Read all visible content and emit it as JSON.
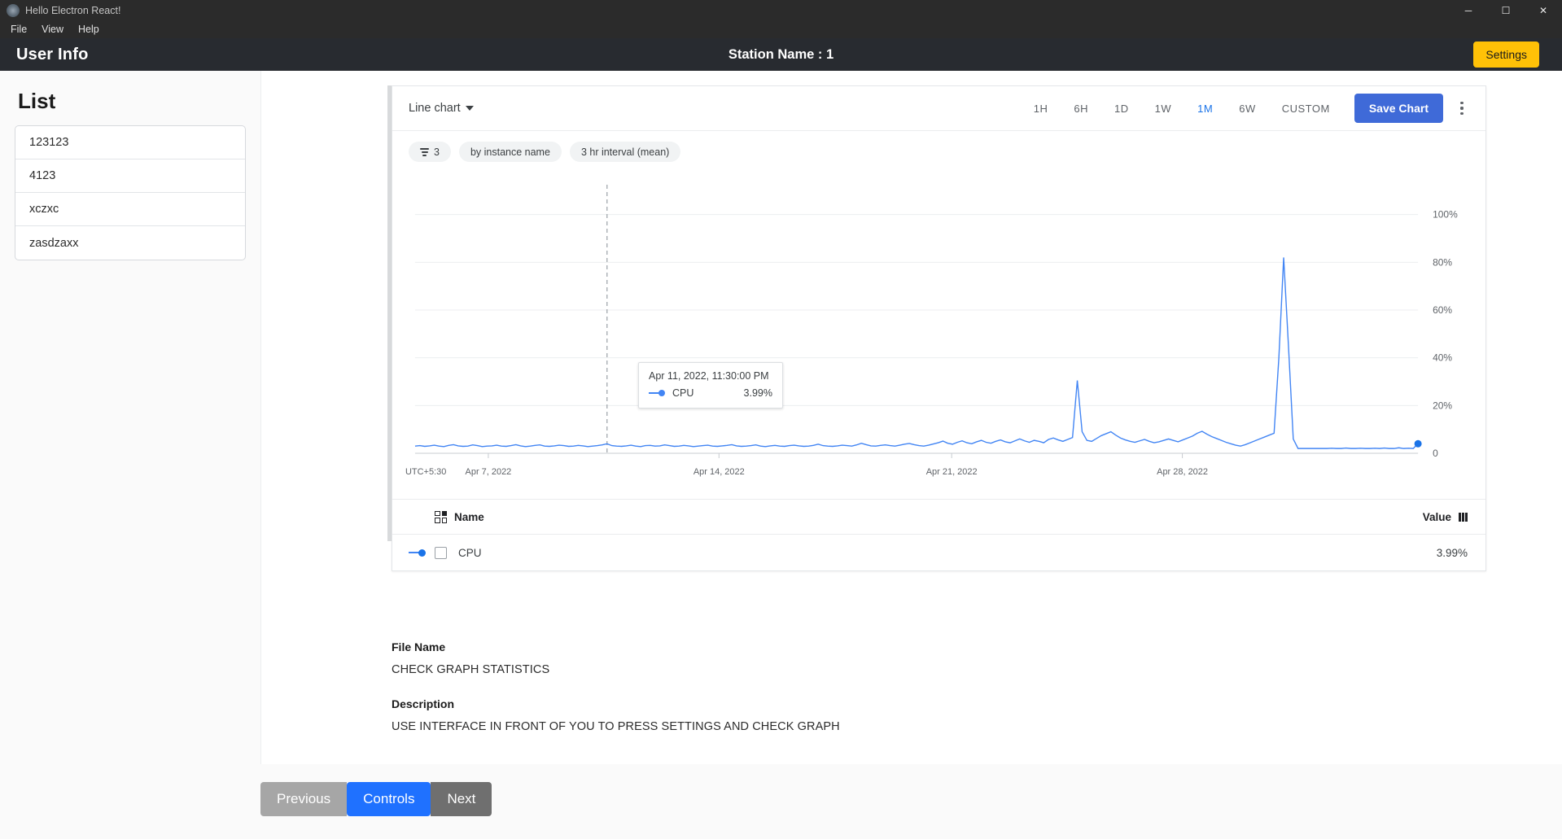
{
  "window": {
    "title": "Hello Electron React!",
    "app_icon": "electron-icon",
    "minimize": "─",
    "maximize": "☐",
    "close": "✕"
  },
  "menubar": {
    "items": [
      "File",
      "View",
      "Help"
    ]
  },
  "header": {
    "left_title": "User Info",
    "center_title": "Station Name : 1",
    "settings_label": "Settings",
    "settings_color": "#ffc107"
  },
  "sidebar": {
    "title": "List",
    "items": [
      {
        "label": "123123"
      },
      {
        "label": "4123"
      },
      {
        "label": "xczxc"
      },
      {
        "label": "zasdzaxx"
      }
    ]
  },
  "chart_card": {
    "chart_type_label": "Line chart",
    "ranges": [
      {
        "label": "1H",
        "active": false
      },
      {
        "label": "6H",
        "active": false
      },
      {
        "label": "1D",
        "active": false
      },
      {
        "label": "1W",
        "active": false
      },
      {
        "label": "1M",
        "active": true
      },
      {
        "label": "6W",
        "active": false
      },
      {
        "label": "CUSTOM",
        "active": false
      }
    ],
    "save_chart_label": "Save Chart",
    "save_chart_color": "#3f6ad8",
    "active_range_color": "#1a73e8",
    "more_menu": "kebab-menu",
    "chips": [
      {
        "label": "3",
        "icon": "filter-icon"
      },
      {
        "label": "by instance name",
        "icon": ""
      },
      {
        "label": "3 hr interval (mean)",
        "icon": ""
      }
    ],
    "tooltip": {
      "timestamp": "Apr 11, 2022, 11:30:00 PM",
      "series": "CPU",
      "value": "3.99%"
    },
    "legend": {
      "columns": {
        "name": "Name",
        "value": "Value"
      },
      "rows": [
        {
          "name": "CPU",
          "value": "3.99%",
          "checked": false,
          "color": "#4285f4"
        }
      ]
    }
  },
  "chart_data": {
    "type": "line",
    "title": "",
    "xlabel": "",
    "ylabel": "",
    "timezone_label": "UTC+5:30",
    "grid": true,
    "legend_position": "bottom-table",
    "series": [
      {
        "name": "CPU",
        "color": "#4285f4",
        "unit": "%",
        "values": [
          3.0,
          3.2,
          2.9,
          3.1,
          3.4,
          3.0,
          2.8,
          3.3,
          3.6,
          3.1,
          2.9,
          3.0,
          3.5,
          3.2,
          2.8,
          3.0,
          3.1,
          3.4,
          3.0,
          2.9,
          3.2,
          3.6,
          3.1,
          2.8,
          3.0,
          3.3,
          3.5,
          3.0,
          2.9,
          3.1,
          3.4,
          3.2,
          2.9,
          3.0,
          3.3,
          3.1,
          2.8,
          3.0,
          3.2,
          3.5,
          3.99,
          3.2,
          3.0,
          2.9,
          3.1,
          3.4,
          3.0,
          2.8,
          3.2,
          3.3,
          3.0,
          3.1,
          3.5,
          3.2,
          2.9,
          3.0,
          3.3,
          3.1,
          2.8,
          3.0,
          3.2,
          3.4,
          3.0,
          2.9,
          3.1,
          3.3,
          3.6,
          3.1,
          2.9,
          3.0,
          3.2,
          3.5,
          3.0,
          2.8,
          3.1,
          3.3,
          3.0,
          2.9,
          3.2,
          3.4,
          3.1,
          2.9,
          3.0,
          3.3,
          3.8,
          3.2,
          3.0,
          2.9,
          3.1,
          3.4,
          3.2,
          3.0,
          3.5,
          4.2,
          3.6,
          3.1,
          3.0,
          3.3,
          3.5,
          3.2,
          3.0,
          3.4,
          3.8,
          4.1,
          3.6,
          3.2,
          3.0,
          3.4,
          3.9,
          4.4,
          5.1,
          4.2,
          3.8,
          4.6,
          5.2,
          4.4,
          4.0,
          4.8,
          5.4,
          4.6,
          4.2,
          5.0,
          5.6,
          4.8,
          4.4,
          5.2,
          6.0,
          5.2,
          4.6,
          5.4,
          5.0,
          4.4,
          5.8,
          6.4,
          5.6,
          5.0,
          5.8,
          6.6,
          30.5,
          9.0,
          5.4,
          5.0,
          6.2,
          7.4,
          8.2,
          9.0,
          7.6,
          6.4,
          5.6,
          5.0,
          4.6,
          5.2,
          5.8,
          5.0,
          4.4,
          4.8,
          5.4,
          6.0,
          5.4,
          4.8,
          5.6,
          6.4,
          7.2,
          8.4,
          9.2,
          8.0,
          7.0,
          6.2,
          5.4,
          4.6,
          4.0,
          3.4,
          3.0,
          3.6,
          4.4,
          5.2,
          6.0,
          6.8,
          7.6,
          8.4,
          40.0,
          82.0,
          45.0,
          6.0,
          2.0,
          2.0,
          2.0,
          2.0,
          2.0,
          2.0,
          2.0,
          2.1,
          2.0,
          2.0,
          2.2,
          2.0,
          2.0,
          2.1,
          2.0,
          2.0,
          2.1,
          2.0,
          2.2,
          2.0,
          2.0,
          2.3,
          2.0,
          2.1,
          2.0,
          3.99
        ]
      }
    ],
    "y_ticks": [
      "0",
      "20%",
      "40%",
      "60%",
      "80%",
      "100%"
    ],
    "ylim": [
      0,
      105
    ],
    "x_ticks": [
      "Apr 7, 2022",
      "Apr 14, 2022",
      "Apr 21, 2022",
      "Apr 28, 2022"
    ],
    "cursor_label": "Apr 11, 2022, 11:30:00 PM",
    "cursor_value": "3.99%"
  },
  "details": {
    "file_name_label": "File Name",
    "file_name_value": "CHECK GRAPH STATISTICS",
    "description_label": "Description",
    "description_value": "USE INTERFACE IN FRONT OF YOU TO PRESS SETTINGS AND CHECK GRAPH"
  },
  "footer": {
    "previous": "Previous",
    "controls": "Controls",
    "next": "Next",
    "controls_color": "#1f71ff"
  }
}
